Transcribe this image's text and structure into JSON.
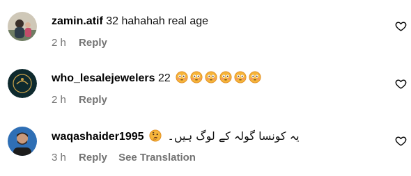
{
  "comments": [
    {
      "username": "zamin.atif",
      "text": "32 hahahah real age",
      "time": "2 h",
      "reply_label": "Reply",
      "avatar_icon": "person-photo-avatar",
      "like_icon": "heart-outline-icon"
    },
    {
      "username": "who_lesalejewelers",
      "text": "22",
      "emojis": [
        "flushed-face",
        "flushed-face",
        "flushed-face",
        "flushed-face",
        "flushed-face",
        "flushed-face"
      ],
      "time": "2 h",
      "reply_label": "Reply",
      "avatar_icon": "jewelry-brand-logo-avatar",
      "like_icon": "heart-outline-icon"
    },
    {
      "username": "waqashaider1995",
      "emojis": [
        "thinking-face"
      ],
      "text": "یہ کونسا گولہ کے لوگ ہیں۔",
      "time": "3 h",
      "reply_label": "Reply",
      "translation_label": "See Translation",
      "avatar_icon": "person-photo-avatar",
      "like_icon": "heart-outline-icon"
    }
  ],
  "colors": {
    "meta_text": "#737373",
    "emoji_fill": "#f6b53b"
  }
}
